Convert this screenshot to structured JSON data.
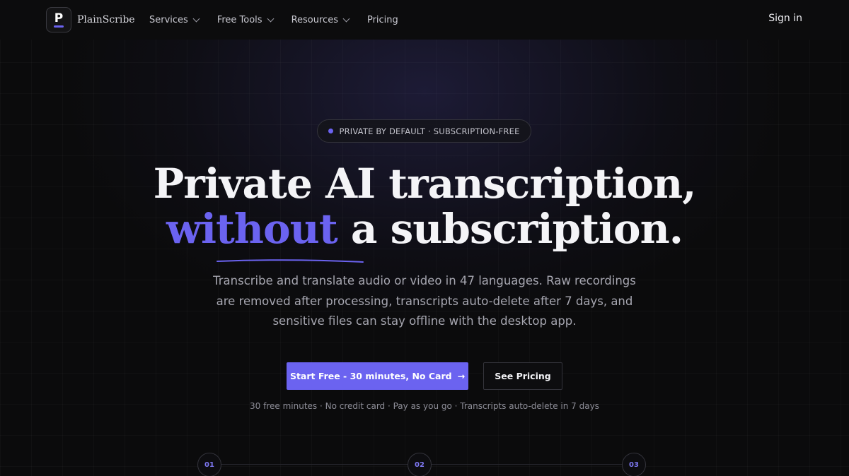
{
  "nav": {
    "logo_letter": "P",
    "brand": "PlainScribe",
    "items": [
      {
        "label": "Services",
        "has_dropdown": true
      },
      {
        "label": "Free Tools",
        "has_dropdown": true
      },
      {
        "label": "Resources",
        "has_dropdown": true
      },
      {
        "label": "Pricing",
        "has_dropdown": false
      }
    ],
    "sign_in": "Sign in"
  },
  "hero": {
    "badge": "PRIVATE BY DEFAULT · SUBSCRIPTION-FREE",
    "headline_line1": "Private AI transcription,",
    "headline_accent": "without",
    "headline_line2_rest": " a subscription.",
    "subtext": "Transcribe and translate audio or video in 47 languages. Raw recordings are removed after processing, transcripts auto-delete after 7 days, and sensitive files can stay offline with the desktop app.",
    "cta_primary": "Start Free - 30 minutes, No Card",
    "cta_primary_arrow": "→",
    "cta_secondary": "See Pricing",
    "note": "30 free minutes · No credit card · Pay as you go · Transcripts auto-delete in 7 days"
  },
  "steps": [
    "01",
    "02",
    "03"
  ],
  "colors": {
    "accent": "#6b63f0",
    "background": "#0b0b0c",
    "text": "#f4f4f7",
    "muted": "#a6a6b0"
  },
  "icons": {
    "logo": "logo-mark-icon",
    "dropdown": "chevron-down-icon",
    "arrow": "arrow-right-icon",
    "badge_dot": "status-dot-icon"
  }
}
